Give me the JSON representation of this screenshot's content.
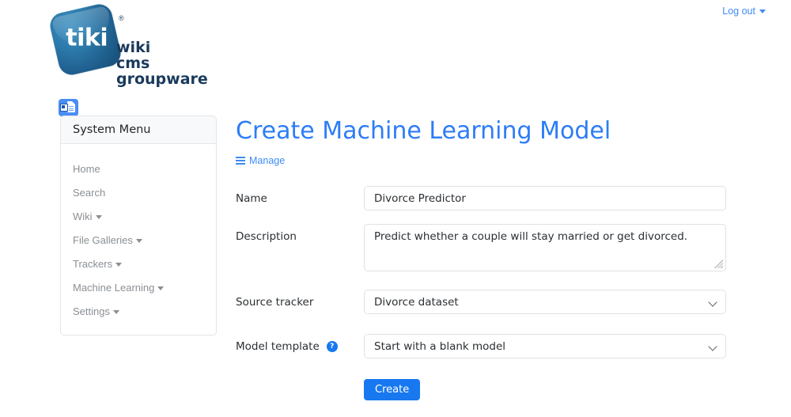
{
  "topbar": {
    "logout_label": "Log out"
  },
  "logo": {
    "wordmark": "tiki",
    "registered": "®",
    "tagline": [
      "wiki",
      "cms",
      "groupware"
    ]
  },
  "sidebar": {
    "toggle_icon": "module-toggle-icon",
    "title": "System Menu",
    "items": [
      {
        "label": "Home",
        "has_caret": false
      },
      {
        "label": "Search",
        "has_caret": false
      },
      {
        "label": "Wiki",
        "has_caret": true
      },
      {
        "label": "File Galleries",
        "has_caret": true
      },
      {
        "label": "Trackers",
        "has_caret": true
      },
      {
        "label": "Machine Learning",
        "has_caret": true
      },
      {
        "label": "Settings",
        "has_caret": true
      }
    ]
  },
  "main": {
    "title": "Create Machine Learning Model",
    "manage_label": "Manage",
    "form": {
      "name": {
        "label": "Name",
        "value": "Divorce Predictor",
        "placeholder": ""
      },
      "description": {
        "label": "Description",
        "value": "Predict whether a couple will stay married or get divorced.",
        "placeholder": ""
      },
      "source_tracker": {
        "label": "Source tracker",
        "value": "Divorce dataset",
        "options": [
          "Divorce dataset"
        ]
      },
      "model_template": {
        "label": "Model template",
        "help_glyph": "?",
        "value": "Start with a blank model",
        "options": [
          "Start with a blank model"
        ]
      },
      "submit_label": "Create"
    }
  },
  "colors": {
    "accent_blue": "#1878f0",
    "link_blue": "#3f8bf4",
    "title_blue": "#2d7df6",
    "logo_navy": "#1a3a5c",
    "border_gray": "#dfe1e5",
    "muted_text": "#8a8f94"
  }
}
